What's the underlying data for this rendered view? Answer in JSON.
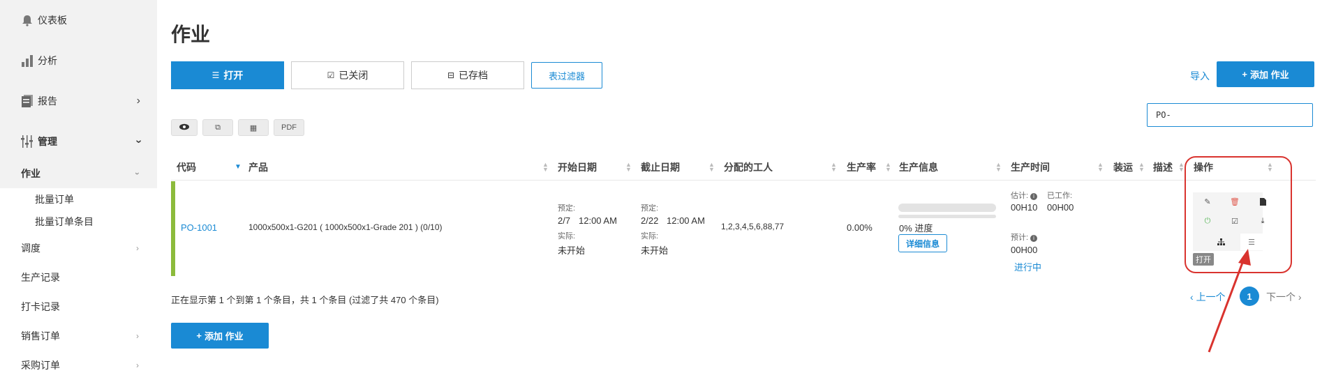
{
  "sidebar": {
    "items": [
      {
        "label": "仪表板",
        "icon": "bell-icon"
      },
      {
        "label": "分析",
        "icon": "bar-chart-icon"
      },
      {
        "label": "报告",
        "icon": "report-icon"
      },
      {
        "label": "管理",
        "icon": "sliders-icon"
      }
    ],
    "sub_items": [
      {
        "label": "作业"
      },
      {
        "label": "调度"
      },
      {
        "label": "生产记录"
      },
      {
        "label": "打卡记录"
      },
      {
        "label": "销售订单"
      },
      {
        "label": "采购订单"
      }
    ],
    "job_sub_items": [
      {
        "label": "批量订单"
      },
      {
        "label": "批量订单条目"
      }
    ]
  },
  "page": {
    "title": "作业"
  },
  "tabs": {
    "open": "打开",
    "closed": "已关闭",
    "archived": "已存档",
    "table_filter": "表过滤器"
  },
  "header": {
    "import": "导入",
    "add_job": "添加 作业"
  },
  "search": {
    "value": "PO-"
  },
  "toolbar": {
    "pdf": "PDF"
  },
  "table": {
    "headers": [
      "代码",
      "产品",
      "开始日期",
      "截止日期",
      "分配的工人",
      "生产率",
      "生产信息",
      "生产时间",
      "装运",
      "描述",
      "操作"
    ],
    "row": {
      "code": "PO-1001",
      "product": "1000x500x1-G201 ( 1000x500x1-Grade 201 ) (0/10)",
      "start": {
        "planned_label": "预定:",
        "planned": "2/7",
        "planned_time": "12:00 AM",
        "actual_label": "实际:",
        "actual": "未开始"
      },
      "end": {
        "planned_label": "预定:",
        "planned": "2/22",
        "planned_time": "12:00 AM",
        "actual_label": "实际:",
        "actual": "未开始"
      },
      "workers": "1,2,3,4,5,6,88,77",
      "rate": "0.00%",
      "progress": {
        "percent": 0,
        "text": "0% 进度",
        "details": "详细信息"
      },
      "time": {
        "estimate_label": "估计:",
        "worked_label": "已工作:",
        "estimate": "00H10",
        "worked": "00H00",
        "expected_label": "预计:",
        "expected": "00H00",
        "status": "进行中"
      },
      "actions": {
        "open_badge": "打开"
      }
    }
  },
  "footer": {
    "info": "正在显示第 1 个到第 1 个条目，共 1 个条目 (过滤了共 470 个条目)",
    "prev": "上一个",
    "page": "1",
    "next": "下一个"
  },
  "colors": {
    "primary": "#1a8ad4",
    "row_indicator": "#8cbb3c",
    "annotation": "#d9332e"
  }
}
